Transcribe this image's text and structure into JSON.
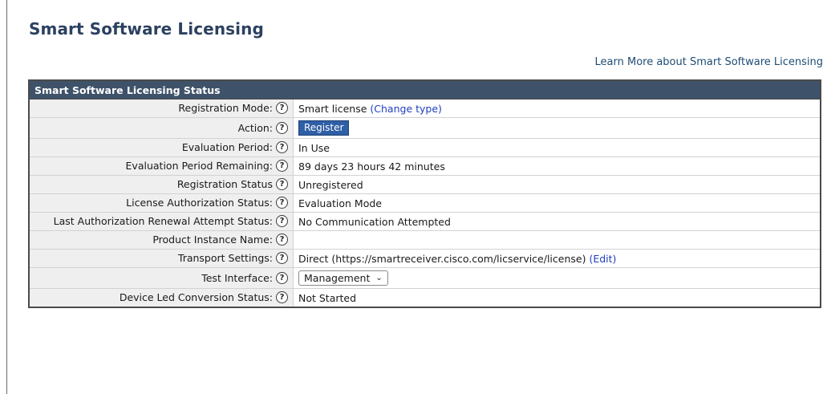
{
  "header": {
    "title": "Smart Software Licensing",
    "learn_more": "Learn More about Smart Software Licensing"
  },
  "panel": {
    "title": "Smart Software Licensing Status",
    "help_glyph": "?",
    "rows": {
      "registration_mode": {
        "label": "Registration Mode:",
        "value": "Smart license",
        "link": "(Change type)"
      },
      "action": {
        "label": "Action:",
        "button": "Register"
      },
      "evaluation_period": {
        "label": "Evaluation Period:",
        "value": "In Use"
      },
      "evaluation_remaining": {
        "label": "Evaluation Period Remaining:",
        "value": "89 days 23 hours 42 minutes"
      },
      "registration_status": {
        "label": "Registration Status",
        "value": "Unregistered"
      },
      "license_authorization": {
        "label": "License Authorization Status:",
        "value": "Evaluation Mode"
      },
      "last_renewal": {
        "label": "Last Authorization Renewal Attempt Status:",
        "value": "No Communication Attempted"
      },
      "product_instance": {
        "label": "Product Instance Name:",
        "value": ""
      },
      "transport_settings": {
        "label": "Transport Settings:",
        "value": "Direct (https://smartreceiver.cisco.com/licservice/license)",
        "link": "(Edit)"
      },
      "test_interface": {
        "label": "Test Interface:",
        "selected": "Management"
      },
      "device_led_conversion": {
        "label": "Device Led Conversion Status:",
        "value": "Not Started"
      }
    }
  }
}
